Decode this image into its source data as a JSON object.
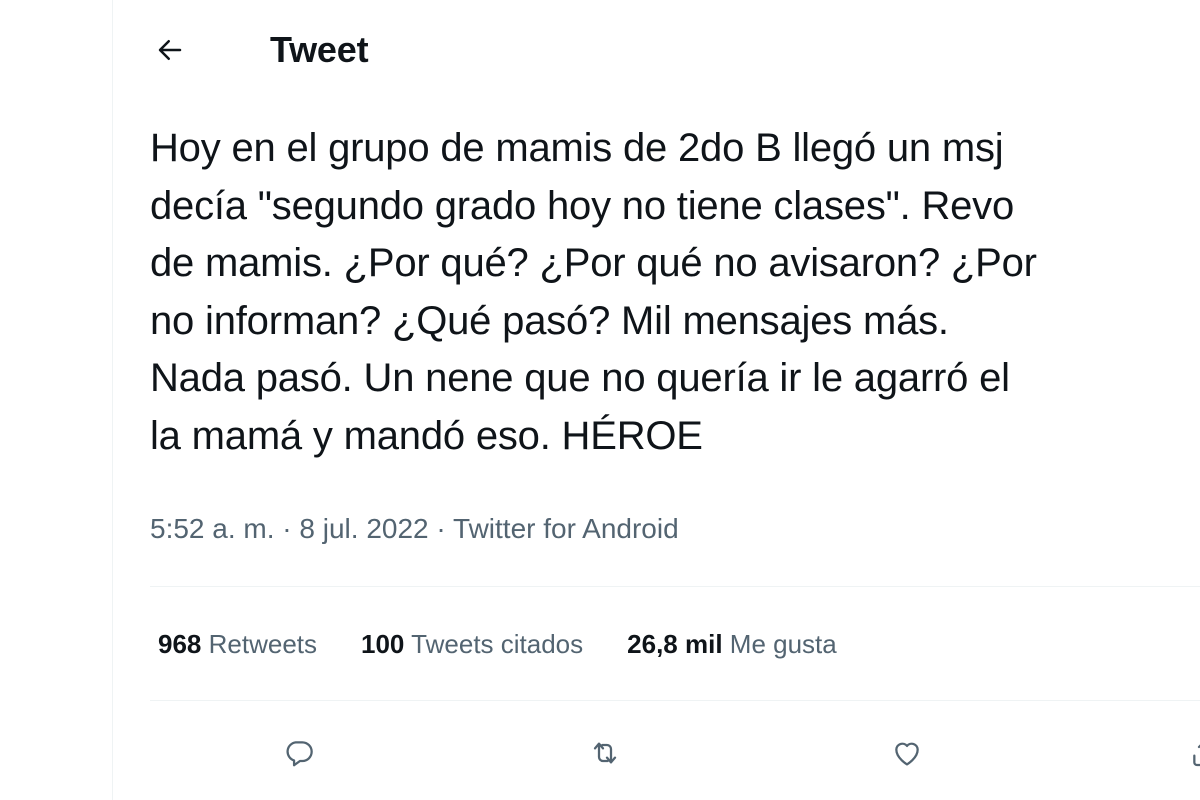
{
  "header": {
    "title": "Tweet",
    "back_icon": "arrow-left-icon"
  },
  "tweet": {
    "lines": [
      "Hoy en el grupo de mamis de 2do B llegó un msj",
      "decía \"segundo grado hoy no tiene clases\". Revo",
      "de mamis. ¿Por qué? ¿Por qué no avisaron? ¿Por",
      "no informan? ¿Qué pasó? Mil mensajes más.",
      "Nada pasó. Un nene que no quería ir le agarró el",
      "la mamá y mandó eso. HÉROE"
    ],
    "time": "5:52 a. m.",
    "separator": "·",
    "date": "8 jul. 2022",
    "source": "Twitter for Android"
  },
  "stats": [
    {
      "value": "968",
      "label": "Retweets"
    },
    {
      "value": "100",
      "label": "Tweets citados"
    },
    {
      "value": "26,8 mil",
      "label": "Me gusta"
    }
  ],
  "actions": [
    {
      "name": "reply",
      "icon": "reply-icon"
    },
    {
      "name": "retweet",
      "icon": "retweet-icon"
    },
    {
      "name": "like",
      "icon": "heart-icon"
    },
    {
      "name": "share",
      "icon": "share-icon"
    }
  ],
  "colors": {
    "text_primary": "#0f1419",
    "text_secondary": "#536471",
    "divider": "#eff3f4",
    "background": "#ffffff"
  }
}
